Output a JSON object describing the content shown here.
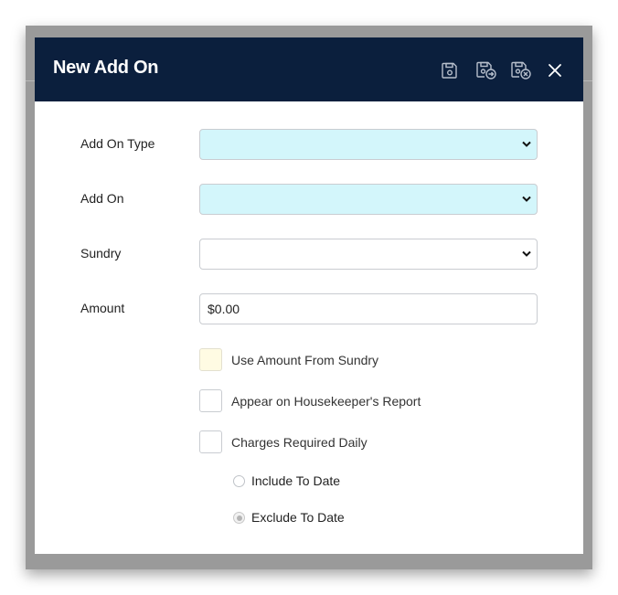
{
  "dialog": {
    "title": "New Add On",
    "actions": {
      "save_icon": "save-icon",
      "save_and_new_icon": "save-and-new-icon",
      "save_and_close_icon": "save-and-close-icon",
      "close_icon": "close-icon"
    }
  },
  "form": {
    "add_on_type": {
      "label": "Add On Type",
      "value": ""
    },
    "add_on": {
      "label": "Add On",
      "value": ""
    },
    "sundry": {
      "label": "Sundry",
      "value": ""
    },
    "amount": {
      "label": "Amount",
      "value": "$0.00"
    },
    "use_amount_from_sundry": {
      "label": "Use Amount From Sundry",
      "checked": false
    },
    "appear_on_housekeepers_report": {
      "label": "Appear on Housekeeper's Report",
      "checked": false
    },
    "charges_required_daily": {
      "label": "Charges Required Daily",
      "checked": false
    },
    "include_to_date": {
      "label": "Include To Date",
      "selected": false
    },
    "exclude_to_date": {
      "label": "Exclude To Date",
      "selected": true
    }
  },
  "colors": {
    "header_bg": "#0b1f3d",
    "required_field_bg": "#d3f6fb",
    "tinted_checkbox_bg": "#fffbe3",
    "backdrop": "#9a9a9a"
  }
}
